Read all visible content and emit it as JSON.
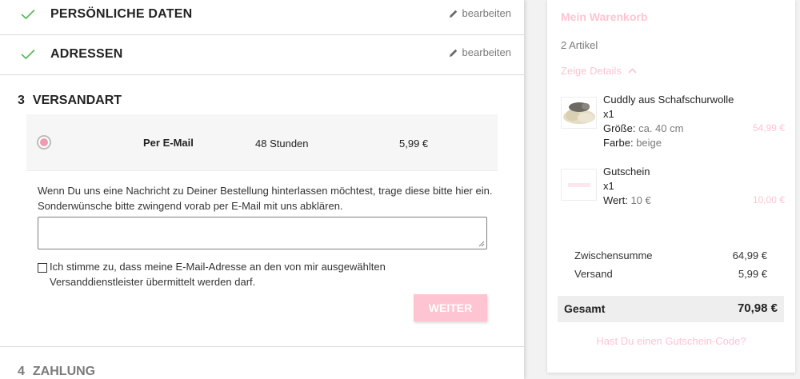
{
  "checkout": {
    "steps": [
      {
        "title": "PERSÖNLICHE DATEN",
        "edit_label": "bearbeiten"
      },
      {
        "title": "ADRESSEN",
        "edit_label": "bearbeiten"
      }
    ],
    "shipping_step": {
      "number": "3",
      "title": "VERSANDART"
    },
    "shipping_option": {
      "name": "Per E-Mail",
      "time": "48 Stunden",
      "price": "5,99 €"
    },
    "note_text": "Wenn Du uns eine Nachricht zu Deiner Bestellung hinterlassen möchtest, trage diese bitte hier ein. Sonderwünsche bitte zwingend vorab per E-Mail mit uns abklären.",
    "message_value": "",
    "agreement_text": "Ich stimme zu, dass meine E-Mail-Adresse an den von mir ausgewählten Versanddienstleister übermittelt werden darf.",
    "continue_label": "WEITER",
    "payment_step": {
      "number": "4",
      "title": "ZAHLUNG"
    }
  },
  "cart": {
    "title": "Mein Warenkorb",
    "count": "2 Artikel",
    "details_label": "Zeige Details",
    "items": [
      {
        "name": "Cuddly aus Schafschurwolle",
        "qty": "x1",
        "attr1_label": "Größe:",
        "attr1_value": "ca. 40 cm",
        "attr2_label": "Farbe:",
        "attr2_value": "beige",
        "price": "54,99 €"
      },
      {
        "name": "Gutschein",
        "qty": "x1",
        "attr1_label": "Wert:",
        "attr1_value": "10 €",
        "price": "10,00 €"
      }
    ],
    "subtotal_label": "Zwischensumme",
    "subtotal_value": "64,99 €",
    "shipping_label": "Versand",
    "shipping_value": "5,99 €",
    "total_label": "Gesamt",
    "total_value": "70,98 €",
    "voucher_label": "Hast Du einen Gutschein-Code?"
  },
  "colors": {
    "accent_pink": "#ffc4d1",
    "check_green": "#5cb85c"
  }
}
